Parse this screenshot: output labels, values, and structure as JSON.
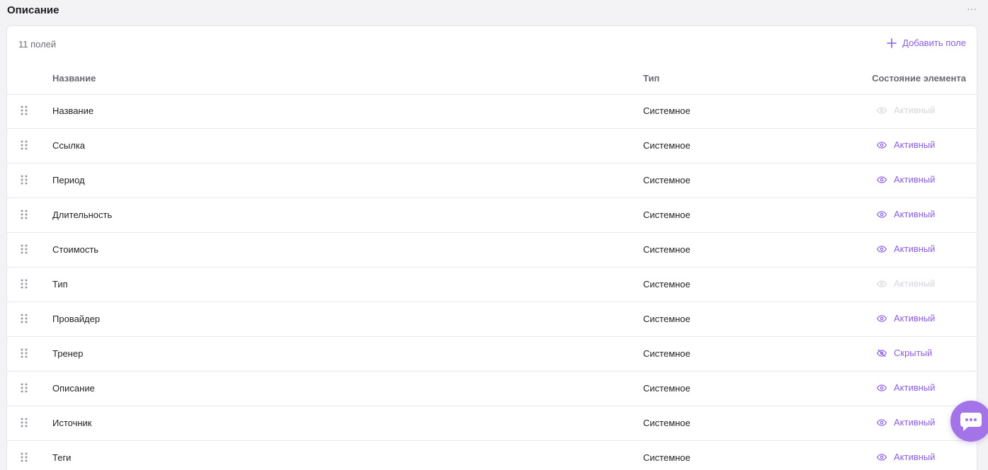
{
  "section": {
    "title": "Описание",
    "more_label": "···"
  },
  "toolbar": {
    "count_label": "11 полей",
    "add_label": "Добавить поле"
  },
  "table": {
    "headers": {
      "name": "Название",
      "type": "Тип",
      "state": "Состояние элемента"
    },
    "rows": [
      {
        "name": "Название",
        "type": "Системное",
        "state": "Активный",
        "icon": "eye-icon",
        "enabled": false
      },
      {
        "name": "Ссылка",
        "type": "Системное",
        "state": "Активный",
        "icon": "eye-icon",
        "enabled": true
      },
      {
        "name": "Период",
        "type": "Системное",
        "state": "Активный",
        "icon": "eye-icon",
        "enabled": true
      },
      {
        "name": "Длительность",
        "type": "Системное",
        "state": "Активный",
        "icon": "eye-icon",
        "enabled": true
      },
      {
        "name": "Стоимость",
        "type": "Системное",
        "state": "Активный",
        "icon": "eye-icon",
        "enabled": true
      },
      {
        "name": "Тип",
        "type": "Системное",
        "state": "Активный",
        "icon": "eye-icon",
        "enabled": false
      },
      {
        "name": "Провайдер",
        "type": "Системное",
        "state": "Активный",
        "icon": "eye-icon",
        "enabled": true
      },
      {
        "name": "Тренер",
        "type": "Системное",
        "state": "Скрытый",
        "icon": "eye-off-icon",
        "enabled": true
      },
      {
        "name": "Описание",
        "type": "Системное",
        "state": "Активный",
        "icon": "eye-icon",
        "enabled": true
      },
      {
        "name": "Источник",
        "type": "Системное",
        "state": "Активный",
        "icon": "eye-icon",
        "enabled": true
      },
      {
        "name": "Теги",
        "type": "Системное",
        "state": "Активный",
        "icon": "eye-icon",
        "enabled": true
      }
    ]
  },
  "colors": {
    "accent": "#8b5ce0",
    "disabled": "#d6d6dc",
    "chat_button": "#a374e8"
  },
  "icons": {
    "add": "plus-icon",
    "handle": "drag-handle-icon",
    "chat": "chat-icon"
  }
}
